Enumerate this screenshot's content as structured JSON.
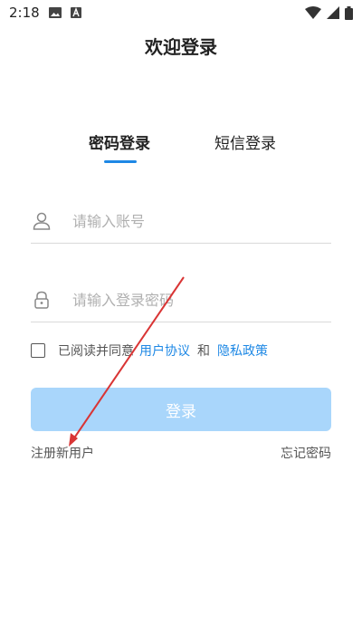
{
  "status_bar": {
    "time": "2:18",
    "left_icons": [
      "image-icon",
      "a-icon"
    ],
    "right_icons": [
      "wifi-icon",
      "signal-icon",
      "battery-icon"
    ]
  },
  "header": {
    "title": "欢迎登录"
  },
  "tabs": [
    {
      "label": "密码登录",
      "active": true
    },
    {
      "label": "短信登录",
      "active": false
    }
  ],
  "form": {
    "account_placeholder": "请输入账号",
    "password_placeholder": "请输入登录密码"
  },
  "agreement": {
    "prefix": "已阅读并同意",
    "user_agreement": "用户协议",
    "and": "和",
    "privacy_policy": "隐私政策",
    "checked": false
  },
  "login_button": {
    "label": "登录"
  },
  "links": {
    "register": "注册新用户",
    "forgot_password": "忘记密码"
  },
  "colors": {
    "accent": "#1e88e5",
    "button_disabled": "#a9d6fb",
    "annotation_arrow": "#d93535"
  }
}
